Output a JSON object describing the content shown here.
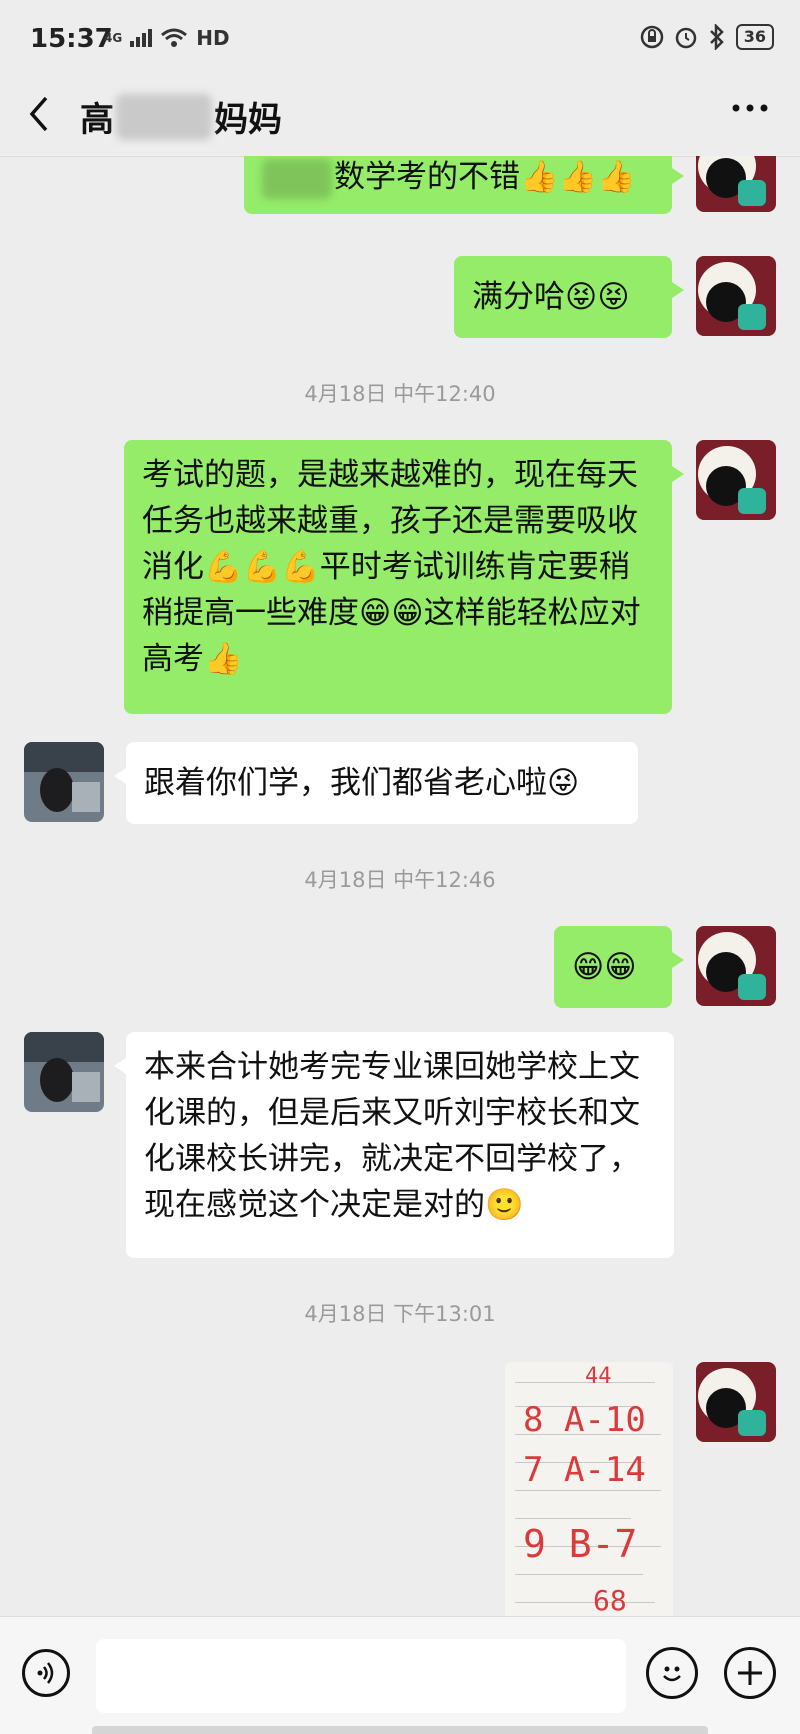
{
  "status": {
    "time": "15:37",
    "network": "4G",
    "hd": "HD",
    "battery": "36"
  },
  "header": {
    "title_prefix": "高",
    "title_suffix": "妈妈",
    "back_icon": "chevron-left-icon",
    "more_icon": "more-icon"
  },
  "messages": [
    {
      "from": "me",
      "text": "数学考的不错👍👍👍"
    },
    {
      "from": "me",
      "text": "满分哈😝😝"
    },
    {
      "type": "time",
      "text": "4月18日 中午12:40"
    },
    {
      "from": "me",
      "text": "考试的题，是越来越难的，现在每天任务也越来越重，孩子还是需要吸收消化💪💪💪平时考试训练肯定要稍稍提高一些难度😁😁这样能轻松应对高考👍"
    },
    {
      "from": "them",
      "text": "跟着你们学，我们都省老心啦😜"
    },
    {
      "type": "time",
      "text": "4月18日 中午12:46"
    },
    {
      "from": "me",
      "text": "😁😁"
    },
    {
      "from": "them",
      "text": "本来合计她考完专业课回她学校上文化课的，但是后来又听刘宇校长和文化课校长讲完，就决定不回学校了，现在感觉这个决定是对的🙂"
    },
    {
      "type": "time",
      "text": "4月18日 下午13:01"
    },
    {
      "from": "me",
      "type": "image",
      "handwriting": [
        "44",
        "8 A-10",
        "7 A-14",
        "9 B-7",
        "68"
      ]
    }
  ],
  "input": {
    "placeholder": "",
    "voice_icon": "voice-icon",
    "emoji_icon": "emoji-icon",
    "plus_icon": "plus-icon"
  },
  "colors": {
    "background": "#ededed",
    "my_bubble": "#95ec69",
    "their_bubble": "#ffffff",
    "timestamp": "#9a9a9a"
  }
}
